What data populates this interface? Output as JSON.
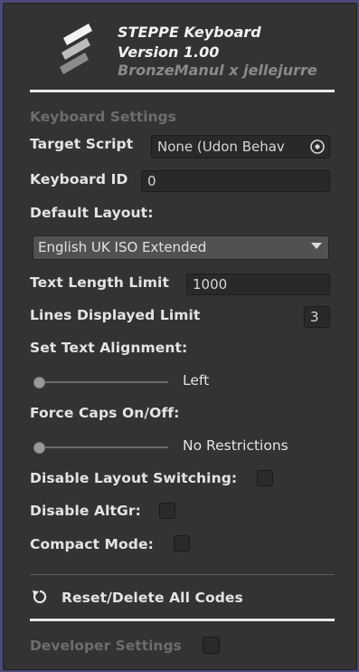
{
  "header": {
    "title": "STEPPE Keyboard",
    "version": "Version 1.00",
    "credits": "BronzeManul x jellejurre"
  },
  "sections": {
    "keyboard_settings": "Keyboard Settings",
    "developer_settings": "Developer Settings"
  },
  "fields": {
    "target_script_label": "Target Script",
    "target_script_value": "None (Udon Behav",
    "keyboard_id_label": "Keyboard ID",
    "keyboard_id_value": "0",
    "default_layout_label": "Default Layout:",
    "default_layout_value": "English UK ISO Extended",
    "text_length_limit_label": "Text Length Limit",
    "text_length_limit_value": "1000",
    "lines_displayed_limit_label": "Lines Displayed Limit",
    "lines_displayed_limit_value": "3",
    "set_text_alignment_label": "Set Text Alignment:",
    "set_text_alignment_value": "Left",
    "force_caps_label": "Force Caps On/Off:",
    "force_caps_value": "No Restrictions",
    "disable_layout_switching_label": "Disable Layout Switching:",
    "disable_altgr_label": "Disable AltGr:",
    "compact_mode_label": "Compact Mode:"
  },
  "actions": {
    "reset_delete_label": "Reset/Delete All Codes"
  },
  "icons": {
    "logo": "keyboard-keys-logo",
    "object_picker": "target-circle-icon",
    "dropdown": "triangle-down-icon",
    "reset": "reset-arrow-icon"
  },
  "state": {
    "set_text_alignment_slider": 0,
    "force_caps_slider": 0,
    "disable_layout_switching": false,
    "disable_altgr": false,
    "compact_mode": false,
    "developer_settings": false
  }
}
